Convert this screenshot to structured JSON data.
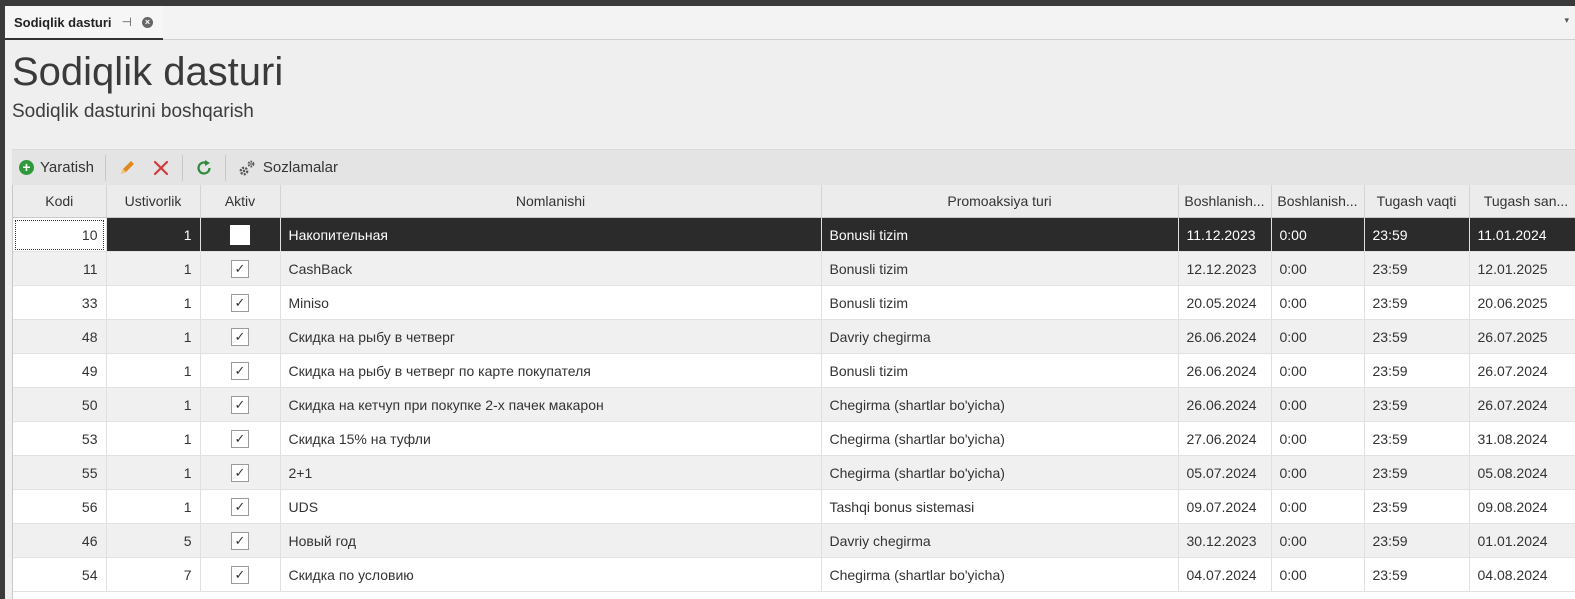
{
  "tab": {
    "title": "Sodiqlik dasturi",
    "pin_glyph": "⊣",
    "close_glyph": "×",
    "menu_glyph": "▾"
  },
  "page": {
    "title": "Sodiqlik dasturi",
    "subtitle": "Sodiqlik dasturini boshqarish"
  },
  "toolbar": {
    "create_label": "Yaratish",
    "settings_label": "Sozlamalar"
  },
  "table": {
    "headers": [
      "Kodi",
      "Ustivorlik",
      "Aktiv",
      "Nomlanishi",
      "Promoaksiya turi",
      "Boshlanish...",
      "Boshlanish...",
      "Tugash vaqti",
      "Tugash san..."
    ],
    "rows": [
      {
        "kodi": "10",
        "ustivorlik": "1",
        "aktiv": "",
        "nom": "Накопительная",
        "tur": "Bonusli tizim",
        "bsana": "11.12.2023",
        "bvaqt": "0:00",
        "tvaqt": "23:59",
        "tsana": "11.01.2024"
      },
      {
        "kodi": "11",
        "ustivorlik": "1",
        "aktiv": "✓",
        "nom": "CashBack",
        "tur": "Bonusli tizim",
        "bsana": "12.12.2023",
        "bvaqt": "0:00",
        "tvaqt": "23:59",
        "tsana": "12.01.2025"
      },
      {
        "kodi": "33",
        "ustivorlik": "1",
        "aktiv": "✓",
        "nom": "Miniso",
        "tur": "Bonusli tizim",
        "bsana": "20.05.2024",
        "bvaqt": "0:00",
        "tvaqt": "23:59",
        "tsana": "20.06.2025"
      },
      {
        "kodi": "48",
        "ustivorlik": "1",
        "aktiv": "✓",
        "nom": "Скидка на рыбу в четверг",
        "tur": "Davriy chegirma",
        "bsana": "26.06.2024",
        "bvaqt": "0:00",
        "tvaqt": "23:59",
        "tsana": "26.07.2025"
      },
      {
        "kodi": "49",
        "ustivorlik": "1",
        "aktiv": "✓",
        "nom": "Скидка на рыбу в четверг по карте покупателя",
        "tur": "Bonusli tizim",
        "bsana": "26.06.2024",
        "bvaqt": "0:00",
        "tvaqt": "23:59",
        "tsana": "26.07.2024"
      },
      {
        "kodi": "50",
        "ustivorlik": "1",
        "aktiv": "✓",
        "nom": "Скидка на кетчуп при покупке 2-х пачек макарон",
        "tur": "Chegirma (shartlar bo'yicha)",
        "bsana": "26.06.2024",
        "bvaqt": "0:00",
        "tvaqt": "23:59",
        "tsana": "26.07.2024"
      },
      {
        "kodi": "53",
        "ustivorlik": "1",
        "aktiv": "✓",
        "nom": "Скидка 15% на туфли",
        "tur": "Chegirma (shartlar bo'yicha)",
        "bsana": "27.06.2024",
        "bvaqt": "0:00",
        "tvaqt": "23:59",
        "tsana": "31.08.2024"
      },
      {
        "kodi": "55",
        "ustivorlik": "1",
        "aktiv": "✓",
        "nom": "2+1",
        "tur": "Chegirma (shartlar bo'yicha)",
        "bsana": "05.07.2024",
        "bvaqt": "0:00",
        "tvaqt": "23:59",
        "tsana": "05.08.2024"
      },
      {
        "kodi": "56",
        "ustivorlik": "1",
        "aktiv": "✓",
        "nom": "UDS",
        "tur": "Tashqi bonus sistemasi",
        "bsana": "09.07.2024",
        "bvaqt": "0:00",
        "tvaqt": "23:59",
        "tsana": "09.08.2024"
      },
      {
        "kodi": "46",
        "ustivorlik": "5",
        "aktiv": "✓",
        "nom": "Новый год",
        "tur": "Davriy chegirma",
        "bsana": "30.12.2023",
        "bvaqt": "0:00",
        "tvaqt": "23:59",
        "tsana": "01.01.2024"
      },
      {
        "kodi": "54",
        "ustivorlik": "7",
        "aktiv": "✓",
        "nom": "Скидка по условию",
        "tur": "Chegirma (shartlar bo'yicha)",
        "bsana": "04.07.2024",
        "bvaqt": "0:00",
        "tvaqt": "23:59",
        "tsana": "04.08.2024"
      }
    ]
  },
  "colors": {
    "selected_row": "#2b2b2b",
    "create_icon": "#2f9a3c",
    "edit_icon": "#e08a1e",
    "delete_icon": "#d23a3a",
    "refresh_icon": "#2e8b3a"
  },
  "icons": [
    "plus-circle-icon",
    "pencil-icon",
    "x-icon",
    "refresh-icon",
    "gears-icon",
    "pin-icon",
    "close-icon",
    "chevron-down-icon"
  ]
}
